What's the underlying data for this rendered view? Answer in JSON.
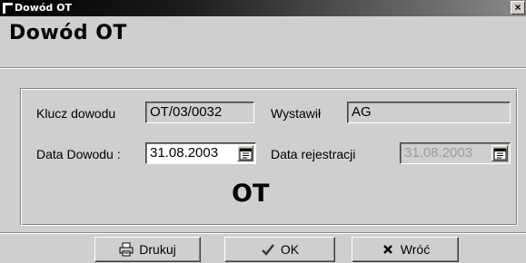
{
  "window": {
    "title": "Dowód OT",
    "close_label": "×"
  },
  "heading": "Dowód OT",
  "form": {
    "klucz_label": "Klucz dowodu",
    "klucz_value": "OT/03/0032",
    "wystawil_label": "Wystawił",
    "wystawil_value": "AG",
    "data_dowodu_label": "Data Dowodu :",
    "data_dowodu_value": "31.08.2003",
    "data_rejestracji_label": "Data rejestracji",
    "data_rejestracji_value": "31.08.2003",
    "doc_type": "OT"
  },
  "buttons": {
    "print_label": "Drukuj",
    "ok_label": "OK",
    "back_label": "Wróć"
  },
  "icons": {
    "print": "printer-icon",
    "ok": "checkmark-icon",
    "back": "x-mark-icon",
    "calendar": "calendar-icon"
  }
}
